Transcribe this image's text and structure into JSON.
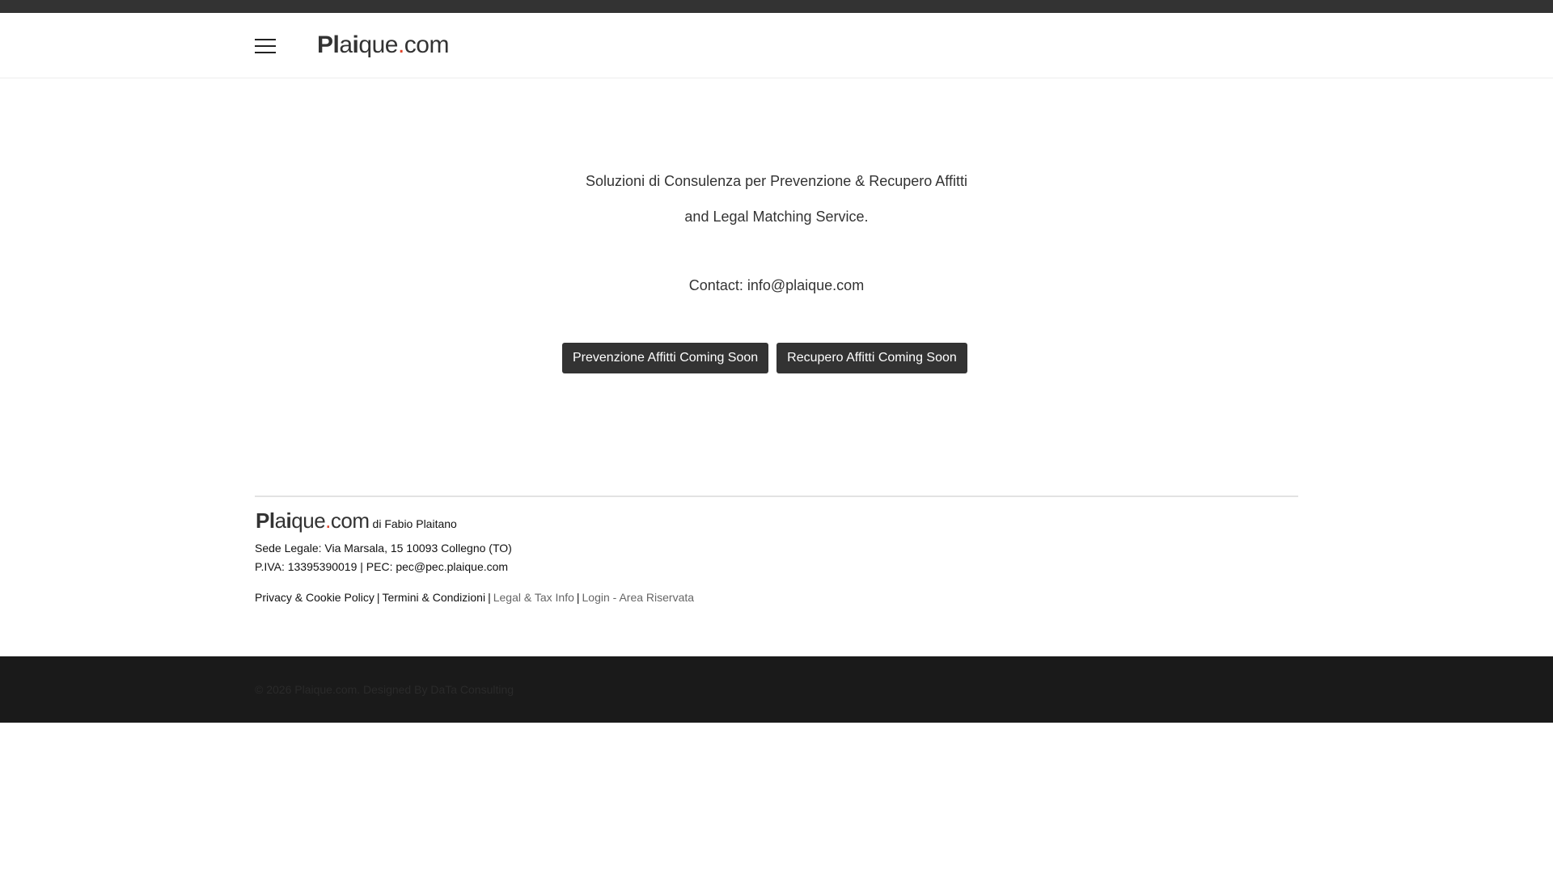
{
  "header": {
    "menu_icon": "hamburger-menu-icon",
    "logo": {
      "part1": "Pl",
      "part2": "a",
      "part3": "i",
      "part4": "que",
      "dot": ".",
      "part5": "com"
    }
  },
  "hero": {
    "line1": "Soluzioni di Consulenza per Prevenzione & Recupero Affitti",
    "line2": "and Legal Matching Service.",
    "contact": "Contact: info@plaique.com"
  },
  "buttons": {
    "prevenzione": "Prevenzione Affitti Coming Soon",
    "recupero": "Recupero Affitti Coming Soon"
  },
  "footer": {
    "logo": {
      "part1": "Pl",
      "part2": "a",
      "part3": "i",
      "part4": "que",
      "dot": ".",
      "part5": "com"
    },
    "by": "di Fabio Plaitano",
    "address": "Sede Legale: Via Marsala, 15 10093 Collegno (TO)",
    "tax": "P.IVA: 13395390019 | PEC: pec@pec.plaique.com",
    "links": {
      "privacy": "Privacy & Cookie Policy",
      "sep": "|",
      "terms": "Termini & Condizioni",
      "legal": "Legal & Tax Info",
      "login": "Login - Area Riservata"
    },
    "copyright": "© 2026 Plaique.com. Designed By DaTa Consulting"
  },
  "colors": {
    "accent_dot": "#e0452b",
    "button_bg": "#333333",
    "bottom_bar": "#1a1a1a"
  }
}
